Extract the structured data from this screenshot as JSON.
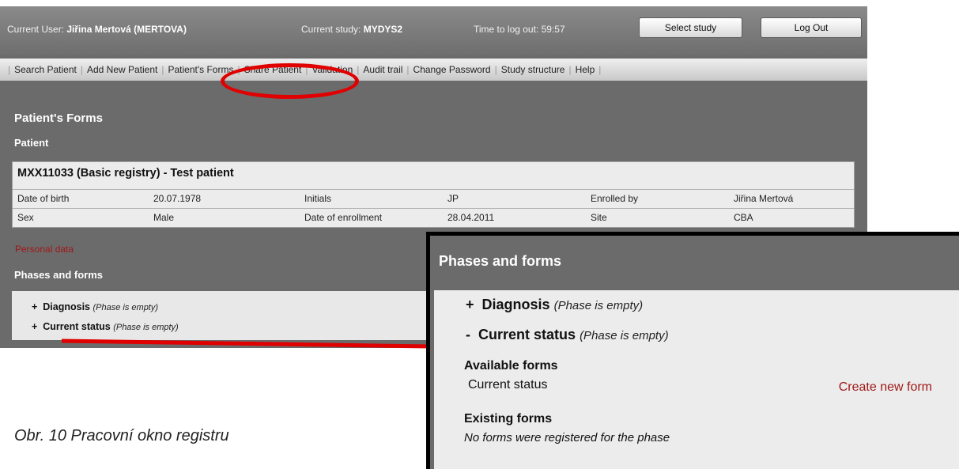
{
  "header": {
    "current_user_label": "Current User:",
    "current_user_value": "Jiřina Mertová (MERTOVA)",
    "current_study_label": "Current study:",
    "current_study_value": "MYDYS2",
    "logout_time_label": "Time to log out:",
    "logout_time_value": "59:57",
    "select_study_button": "Select study",
    "log_out_button": "Log Out"
  },
  "nav": {
    "items": [
      "Search Patient",
      "Add New Patient",
      "Patient's Forms",
      "Share Patient",
      "Validation",
      "Audit trail",
      "Change Password",
      "Study structure",
      "Help"
    ]
  },
  "page": {
    "title": "Patient's Forms",
    "patient_heading": "Patient"
  },
  "patient": {
    "title": "MXX11033 (Basic registry) - Test patient",
    "rows": [
      {
        "k1": "Date of birth",
        "v1": "20.07.1978",
        "k2": "Initials",
        "v2": "JP",
        "k3": "Enrolled by",
        "v3": "Jiřina Mertová"
      },
      {
        "k1": "Sex",
        "v1": "Male",
        "k2": "Date of enrollment",
        "v2": "28.04.2011",
        "k3": "Site",
        "v3": "CBA"
      }
    ]
  },
  "personal_data_link": "Personal data",
  "phases": {
    "heading": "Phases and forms",
    "items": [
      {
        "sign": "+",
        "name": "Diagnosis",
        "note": "(Phase is empty)"
      },
      {
        "sign": "+",
        "name": "Current status",
        "note": "(Phase is empty)"
      }
    ]
  },
  "zoom": {
    "heading": "Phases and forms",
    "items": [
      {
        "sign": "+",
        "name": "Diagnosis",
        "note": "(Phase is empty)"
      },
      {
        "sign": "-",
        "name": "Current status",
        "note": "(Phase is empty)"
      }
    ],
    "available_forms_label": "Available forms",
    "available_form_name": "Current status",
    "create_new_form": "Create new form",
    "existing_forms_label": "Existing forms",
    "no_forms_text": "No forms were registered for the phase"
  },
  "caption": "Obr. 10 Pracovní okno registru",
  "colors": {
    "annotation": "#e00000",
    "link": "#a01818",
    "panel_bg": "#6b6b6b"
  }
}
